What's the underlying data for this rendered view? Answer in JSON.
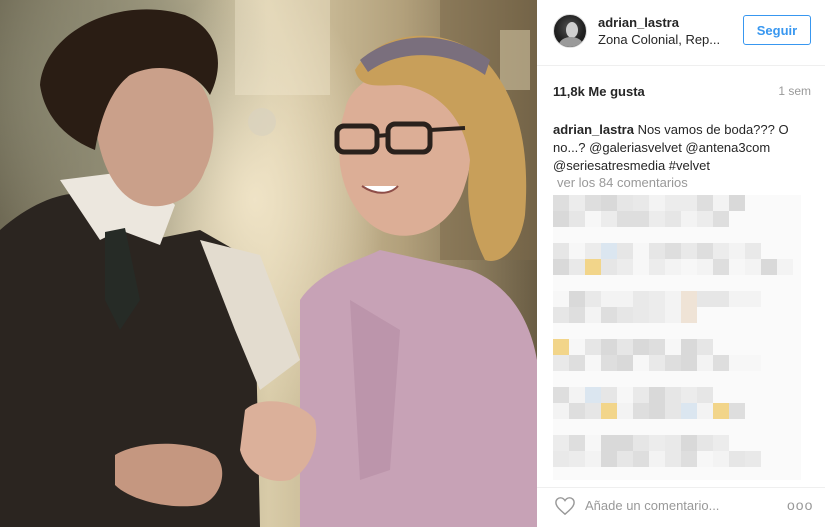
{
  "post": {
    "username": "adrian_lastra",
    "location": "Zona Colonial, Rep...",
    "follow_label": "Seguir",
    "likes": "11,8k Me gusta",
    "time": "1 sem",
    "caption_user": "adrian_lastra",
    "caption_text": "Nos vamos de boda??? O no...? @galeriasvelvet @antena3com @seriesatresmedia #velvet",
    "view_comments": "ver los 84 comentarios",
    "comment_placeholder": "Añade un comentario...",
    "more_label": "ooo"
  },
  "icons": {
    "like": "heart-icon",
    "more": "more-options-icon",
    "avatar": "avatar"
  },
  "colors": {
    "link": "#3897f0",
    "text": "#262626",
    "muted": "#999999"
  }
}
